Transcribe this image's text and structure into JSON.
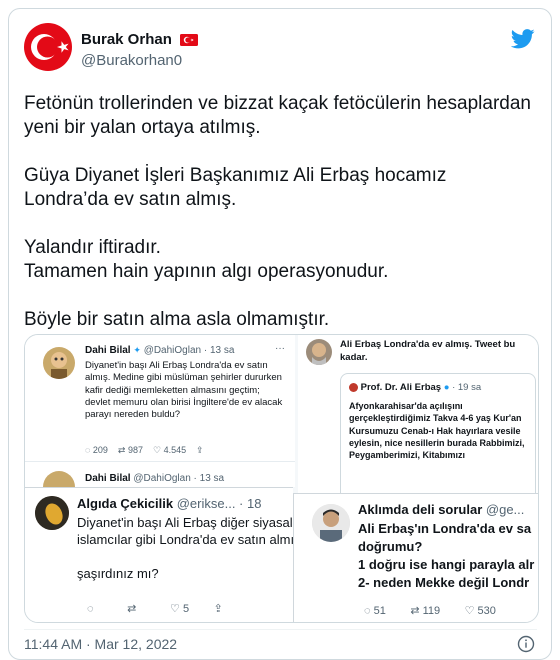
{
  "author": {
    "display_name": "Burak Orhan",
    "handle": "@Burakorhan0",
    "flag": "turkey-flag-icon",
    "verified": false
  },
  "tweet": {
    "text": "Fetönün trollerinden ve bizzat kaçak fetöcülerin hesaplardan yeni bir yalan ortaya atılmış.\n\nGüya Diyanet İşleri Başkanımız Ali Erbaş hocamız Londra’da ev satın almış.\n\nYalandır iftiradır.\nTamamen hain yapının algı operasyonudur.\n\nBöyle bir satın alma asla olmamıştır.",
    "timestamp": "11:44 AM · Mar 12, 2022"
  },
  "media": {
    "shot1": {
      "name": "Dahi Bilal",
      "handle": "@DahiOglan · 13 sa",
      "text": "Diyanet'in başı  Ali Erbaş Londra'da ev satın almış. Medine gibi müslüman şehirler dururken kafir dediği memleketten almasını geçtim; devlet memuru olan birisi İngiltere'de ev alacak parayı nereden buldu?",
      "replies": "209",
      "retweets": "987",
      "likes": "4.545",
      "next_name": "Dahi Bilal",
      "next_handle": "@DahiOglan · 13 sa"
    },
    "shot2": {
      "text": "Ali Erbaş Londra'da ev almış. Tweet bu kadar.",
      "quoted_name": "Prof. Dr. Ali Erbaş",
      "quoted_time": "· 19 sa",
      "quoted_text": "Afyonkarahisar'da açılışını gerçekleştirdiğimiz Takva 4-6 yaş Kur'an Kursumuzu Cenab-ı Hak hayırlara vesile eylesin, nice nesillerin burada Rabbimizi, Peygamberimizi, Kitabımızı"
    },
    "shot3": {
      "name": "Algıda Çekicilik",
      "handle": "@erikse... · 18",
      "text": "Diyanet'in başı  Ali Erbaş diğer siyasal islamcılar gibi Londra'da ev satın almış.\n\nşaşırdınız mı?",
      "likes": "5"
    },
    "shot4": {
      "name": "Aklımda deli sorular",
      "handle": "@ge...",
      "text": "Ali Erbaş'ın Londra'da ev sa doğrumu?\n1 doğru ise hangi parayla alr\n2- neden Mekke değil Londr",
      "replies": "51",
      "retweets": "119",
      "likes": "530"
    }
  },
  "colors": {
    "twitter_blue": "#1d9bf0",
    "turkey_red": "#e30a17",
    "text_secondary": "#536471",
    "border": "#cfd9de"
  }
}
